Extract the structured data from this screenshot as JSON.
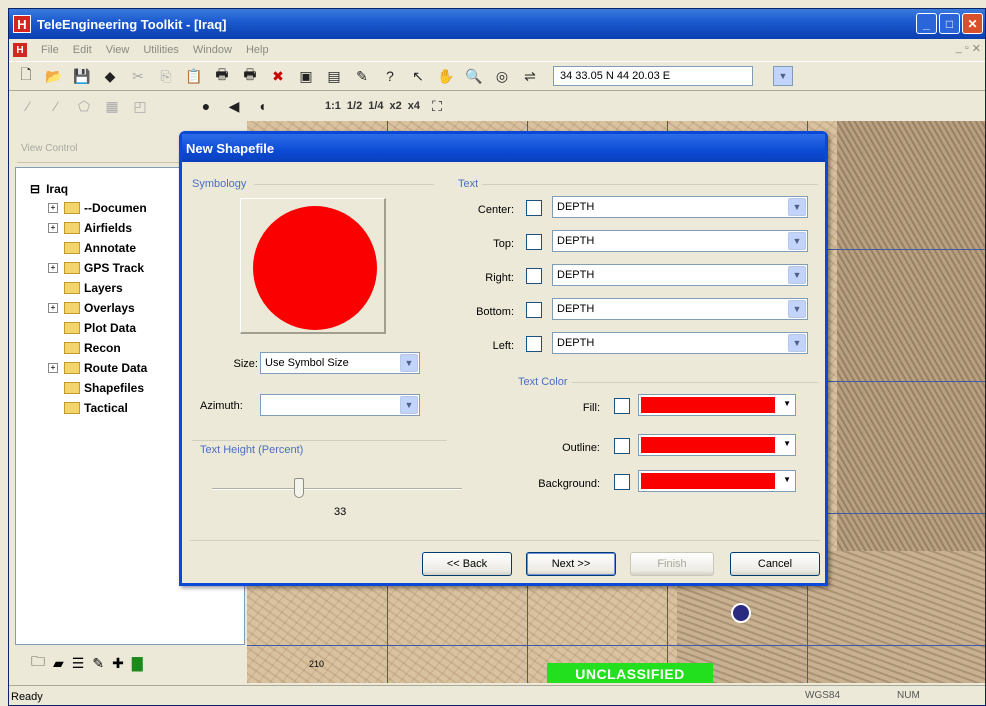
{
  "app": {
    "title": "TeleEngineering Toolkit - [Iraq]",
    "logo": "H",
    "menu": [
      "File",
      "Edit",
      "View",
      "Utilities",
      "Window",
      "Help"
    ],
    "mdi_buttons": [
      "_",
      "▫",
      "✕"
    ]
  },
  "toolbar": {
    "coordinates": "34 33.05 N  44 20.03 E",
    "zoom_labels": [
      "1:1",
      "1/2",
      "1/4",
      "x2",
      "x4"
    ]
  },
  "sidebar": {
    "view_control_label": "View Control",
    "root": "Iraq",
    "items": [
      {
        "label": "--Documen",
        "expand": "+"
      },
      {
        "label": "Airfields",
        "expand": "+"
      },
      {
        "label": "Annotate",
        "expand": ""
      },
      {
        "label": "GPS Track",
        "expand": "+"
      },
      {
        "label": "Layers",
        "expand": ""
      },
      {
        "label": "Overlays",
        "expand": "+"
      },
      {
        "label": "Plot Data",
        "expand": ""
      },
      {
        "label": "Recon",
        "expand": ""
      },
      {
        "label": "Route Data",
        "expand": "+"
      },
      {
        "label": "Shapefiles",
        "expand": ""
      },
      {
        "label": "Tactical",
        "expand": ""
      }
    ]
  },
  "map": {
    "classification": "UNCLASSIFIED",
    "grid_label": "210"
  },
  "dialog": {
    "title": "New Shapefile",
    "symbology": {
      "group_label": "Symbology",
      "symbol_color": "#fa0000",
      "size_label": "Size:",
      "size_value": "Use Symbol Size",
      "azimuth_label": "Azimuth:",
      "azimuth_value": "",
      "text_height_label": "Text Height (Percent)",
      "text_height_value": "33"
    },
    "text": {
      "group_label": "Text",
      "rows": [
        {
          "label": "Center:",
          "value": "DEPTH",
          "checked": false
        },
        {
          "label": "Top:",
          "value": "DEPTH",
          "checked": false
        },
        {
          "label": "Right:",
          "value": "DEPTH",
          "checked": false
        },
        {
          "label": "Bottom:",
          "value": "DEPTH",
          "checked": false
        },
        {
          "label": "Left:",
          "value": "DEPTH",
          "checked": false
        }
      ]
    },
    "text_color": {
      "group_label": "Text Color",
      "rows": [
        {
          "label": "Fill:",
          "color": "#fa0000"
        },
        {
          "label": "Outline:",
          "color": "#fa0000"
        },
        {
          "label": "Background:",
          "color": "#fa0000"
        }
      ]
    },
    "buttons": {
      "back": "<< Back",
      "next": "Next >>",
      "finish": "Finish",
      "cancel": "Cancel"
    }
  },
  "status": {
    "left": "Ready",
    "datum": "WGS84",
    "num": "NUM"
  }
}
